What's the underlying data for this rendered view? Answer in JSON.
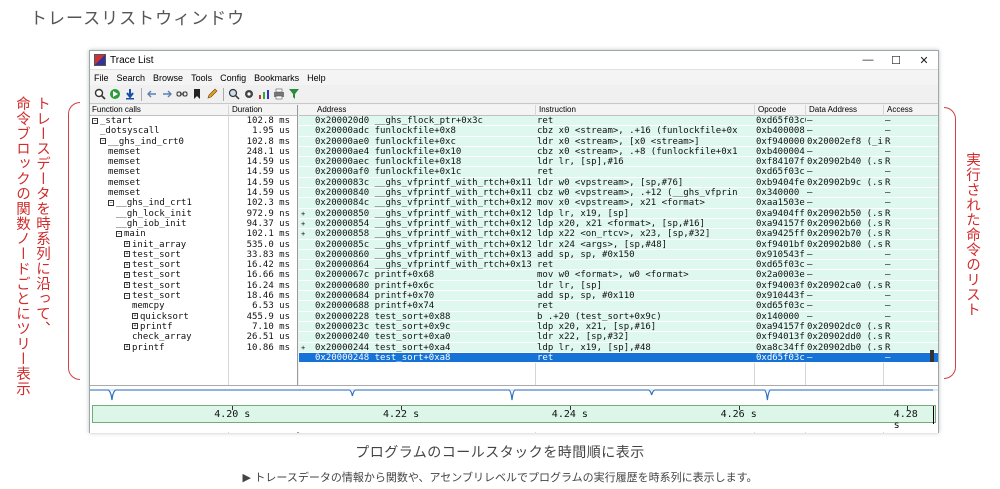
{
  "heading": "トレースリストウィンドウ",
  "window": {
    "title": "Trace List",
    "controls": {
      "minimize": "—",
      "maximize": "☐",
      "close": "✕"
    }
  },
  "menu": [
    "File",
    "Search",
    "Browse",
    "Tools",
    "Config",
    "Bookmarks",
    "Help"
  ],
  "toolbar_icons": [
    "search-icon",
    "go-icon",
    "download-icon",
    "sep",
    "back-icon",
    "forward-icon",
    "link-icon",
    "bookmark-icon",
    "edit-icon",
    "sep",
    "zoom-icon",
    "gear-icon",
    "chart-icon",
    "print-icon",
    "filter-icon"
  ],
  "function_pane": {
    "headers": {
      "name": "Function calls",
      "duration": "Duration"
    },
    "rows": [
      {
        "indent": 0,
        "box": "−",
        "name": "_start",
        "duration": "102.8 ms"
      },
      {
        "indent": 1,
        "box": "",
        "name": "_dotsyscall",
        "duration": "1.95 us"
      },
      {
        "indent": 1,
        "box": "−",
        "name": "__ghs_ind_crt0",
        "duration": "102.8 ms"
      },
      {
        "indent": 2,
        "box": "",
        "name": "memset",
        "duration": "248.1 us"
      },
      {
        "indent": 2,
        "box": "",
        "name": "memset",
        "duration": "14.59 us"
      },
      {
        "indent": 2,
        "box": "",
        "name": "memset",
        "duration": "14.59 us"
      },
      {
        "indent": 2,
        "box": "",
        "name": "memset",
        "duration": "14.59 us"
      },
      {
        "indent": 2,
        "box": "",
        "name": "memset",
        "duration": "14.59 us"
      },
      {
        "indent": 2,
        "box": "−",
        "name": "__ghs_ind_crt1",
        "duration": "102.3 ms"
      },
      {
        "indent": 3,
        "box": "",
        "name": "__gh_lock_init",
        "duration": "972.9 ns"
      },
      {
        "indent": 3,
        "box": "",
        "name": "__gh_iob_init",
        "duration": "94.37 us"
      },
      {
        "indent": 3,
        "box": "−",
        "name": "main",
        "duration": "102.1 ms"
      },
      {
        "indent": 4,
        "box": "+",
        "name": "init_array",
        "duration": "535.0 us"
      },
      {
        "indent": 4,
        "box": "+",
        "name": "test_sort",
        "duration": "33.83 ms"
      },
      {
        "indent": 4,
        "box": "+",
        "name": "test_sort",
        "duration": "16.42 ms"
      },
      {
        "indent": 4,
        "box": "+",
        "name": "test_sort",
        "duration": "16.66 ms"
      },
      {
        "indent": 4,
        "box": "+",
        "name": "test_sort",
        "duration": "16.24 ms"
      },
      {
        "indent": 4,
        "box": "−",
        "name": "test_sort",
        "duration": "18.46 ms"
      },
      {
        "indent": 5,
        "box": "",
        "name": "memcpy",
        "duration": "6.53 us"
      },
      {
        "indent": 5,
        "box": "+",
        "name": "quicksort",
        "duration": "455.9 us"
      },
      {
        "indent": 5,
        "box": "+",
        "name": "printf",
        "duration": "7.10 ms"
      },
      {
        "indent": 5,
        "box": "",
        "name": "check_array",
        "duration": "26.51 us"
      },
      {
        "indent": 4,
        "box": "+",
        "name": "printf",
        "duration": "10.86 ms"
      }
    ]
  },
  "trace_pane": {
    "headers": {
      "address": "Address",
      "instruction": "Instruction",
      "opcode": "Opcode",
      "data": "Data Address",
      "access": "Access"
    },
    "rows": [
      {
        "mark": "",
        "addr": "0x200020d0     __ghs_flock_ptr+0x3c",
        "instr": "ret",
        "op": "0xd65f03c0",
        "data": "–",
        "acc": "–"
      },
      {
        "mark": "",
        "addr": "0x20000adc   funlockfile+0x8",
        "instr": "cbz      x0 <stream>, .+16 (funlockfile+0x",
        "op": "0xb400008",
        "data": "–",
        "acc": "–"
      },
      {
        "mark": "",
        "addr": "0x20000ae0   funlockfile+0xc",
        "instr": "ldr      x0 <stream>, [x0 <stream>]",
        "op": "0xf940000",
        "data": "0x20002ef8 (_i",
        "acc": "R"
      },
      {
        "mark": "",
        "addr": "0x20000ae4   funlockfile+0x10",
        "instr": "cbz      x0 <stream>, .+8 (funlockfile+0x1",
        "op": "0xb400004",
        "data": "–",
        "acc": "–"
      },
      {
        "mark": "",
        "addr": "0x20000aec   funlockfile+0x18",
        "instr": "ldr      lr, [sp],#16",
        "op": "0xf84107f",
        "data": "0x20902b40 (.s",
        "acc": "R"
      },
      {
        "mark": "",
        "addr": "0x20000af0   funlockfile+0x1c",
        "instr": "ret",
        "op": "0xd65f03c",
        "data": "–",
        "acc": "–"
      },
      {
        "mark": "",
        "addr": "0x2000083c   __ghs_vfprintf_with_rtch+0x11",
        "instr": "ldr      w0 <vpstream>, [sp,#76]",
        "op": "0xb9404fe",
        "data": "0x20902b9c (.s",
        "acc": "R"
      },
      {
        "mark": "",
        "addr": "0x20000840   __ghs_vfprintf_with_rtch+0x11",
        "instr": "cbz      w0 <vpstream>, .+12 (__ghs_vfprin",
        "op": "0x340000",
        "data": "–",
        "acc": "–"
      },
      {
        "mark": "",
        "addr": "0x2000084c   __ghs_vfprintf_with_rtch+0x12",
        "instr": "mov      x0 <vpstream>, x21 <format>",
        "op": "0xaa1503e",
        "data": "–",
        "acc": "–"
      },
      {
        "mark": "+",
        "addr": "0x20000850   __ghs_vfprintf_with_rtch+0x12",
        "instr": "ldp      lr, x19, [sp]",
        "op": "0xa9404ff",
        "data": "0x20902b50 (.s",
        "acc": "R"
      },
      {
        "mark": "+",
        "addr": "0x20000854   __ghs_vfprintf_with_rtch+0x12",
        "instr": "ldp      x20, x21 <format>, [sp,#16]",
        "op": "0xa94157f",
        "data": "0x20902b60 (.s",
        "acc": "R"
      },
      {
        "mark": "+",
        "addr": "0x20000858   __ghs_vfprintf_with_rtch+0x12",
        "instr": "ldp      x22 <on_rtcv>, x23, [sp,#32]",
        "op": "0xa9425ff",
        "data": "0x20902b70 (.s",
        "acc": "R"
      },
      {
        "mark": "",
        "addr": "0x2000085c   __ghs_vfprintf_with_rtch+0x12",
        "instr": "ldr      x24 <args>, [sp,#48]",
        "op": "0xf9401bf",
        "data": "0x20902b80 (.s",
        "acc": "R"
      },
      {
        "mark": "",
        "addr": "0x20000860   __ghs_vfprintf_with_rtch+0x13",
        "instr": "add      sp, sp, #0x150",
        "op": "0x910543f",
        "data": "–",
        "acc": "–"
      },
      {
        "mark": "",
        "addr": "0x20000864   __ghs_vfprintf_with_rtch+0x13",
        "instr": "ret",
        "op": "0xd65f03c",
        "data": "–",
        "acc": "–"
      },
      {
        "mark": "",
        "addr": "0x2000067c   printf+0x68",
        "instr": "mov      w0 <format>, w0 <format>",
        "op": "0x2a0003e",
        "data": "–",
        "acc": "–"
      },
      {
        "mark": "",
        "addr": "0x20000680   printf+0x6c",
        "instr": "ldr      lr, [sp]",
        "op": "0xf94003f",
        "data": "0x20902ca0 (.s",
        "acc": "R"
      },
      {
        "mark": "",
        "addr": "0x20000684   printf+0x70",
        "instr": "add      sp, sp, #0x110",
        "op": "0x910443f",
        "data": "–",
        "acc": "–"
      },
      {
        "mark": "",
        "addr": "0x20000688   printf+0x74",
        "instr": "ret",
        "op": "0xd65f03c",
        "data": "–",
        "acc": "–"
      },
      {
        "mark": "",
        "addr": "0x20000228   test_sort+0x88",
        "instr": "b        .+20 (test_sort+0x9c)",
        "op": "0x140000",
        "data": "–",
        "acc": "–"
      },
      {
        "mark": "",
        "addr": "0x2000023c   test_sort+0x9c",
        "instr": "ldp      x20, x21, [sp,#16]",
        "op": "0xa94157f",
        "data": "0x20902dc0 (.s",
        "acc": "R"
      },
      {
        "mark": "",
        "addr": "0x20000240   test_sort+0xa0",
        "instr": "ldr      x22, [sp,#32]",
        "op": "0xf94013f",
        "data": "0x20902dd0 (.s",
        "acc": "R"
      },
      {
        "mark": "+",
        "addr": "0x20000244   test_sort+0xa4",
        "instr": "ldp      lr, x19, [sp],#48",
        "op": "0xa8c34ff",
        "data": "0x20902db0 (.s",
        "acc": "R"
      },
      {
        "mark": "",
        "addr": "0x20000248   test_sort+0xa8",
        "instr": "ret",
        "op": "0xd65f03c",
        "data": "–",
        "acc": "–",
        "selected": true
      }
    ]
  },
  "timeline": {
    "ticks": [
      {
        "label": "4.20 s",
        "frac": 0.165
      },
      {
        "label": "4.22 s",
        "frac": 0.365
      },
      {
        "label": "4.24 s",
        "frac": 0.565
      },
      {
        "label": "4.26 s",
        "frac": 0.765
      },
      {
        "label": "4.28 s",
        "frac": 0.965
      }
    ],
    "cursor_frac": 0.998
  },
  "annotation_left": [
    "トレースデータを時系列に沿って、",
    "命令ブロックの関数ノードごとにツリー表示"
  ],
  "annotation_right": "実行された命令のリスト",
  "caption": "プログラムのコールスタックを時間順に表示",
  "subcaption": "▶ トレースデータの情報から関数や、アセンブリレベルでプログラムの実行履歴を時系列に表示します。"
}
